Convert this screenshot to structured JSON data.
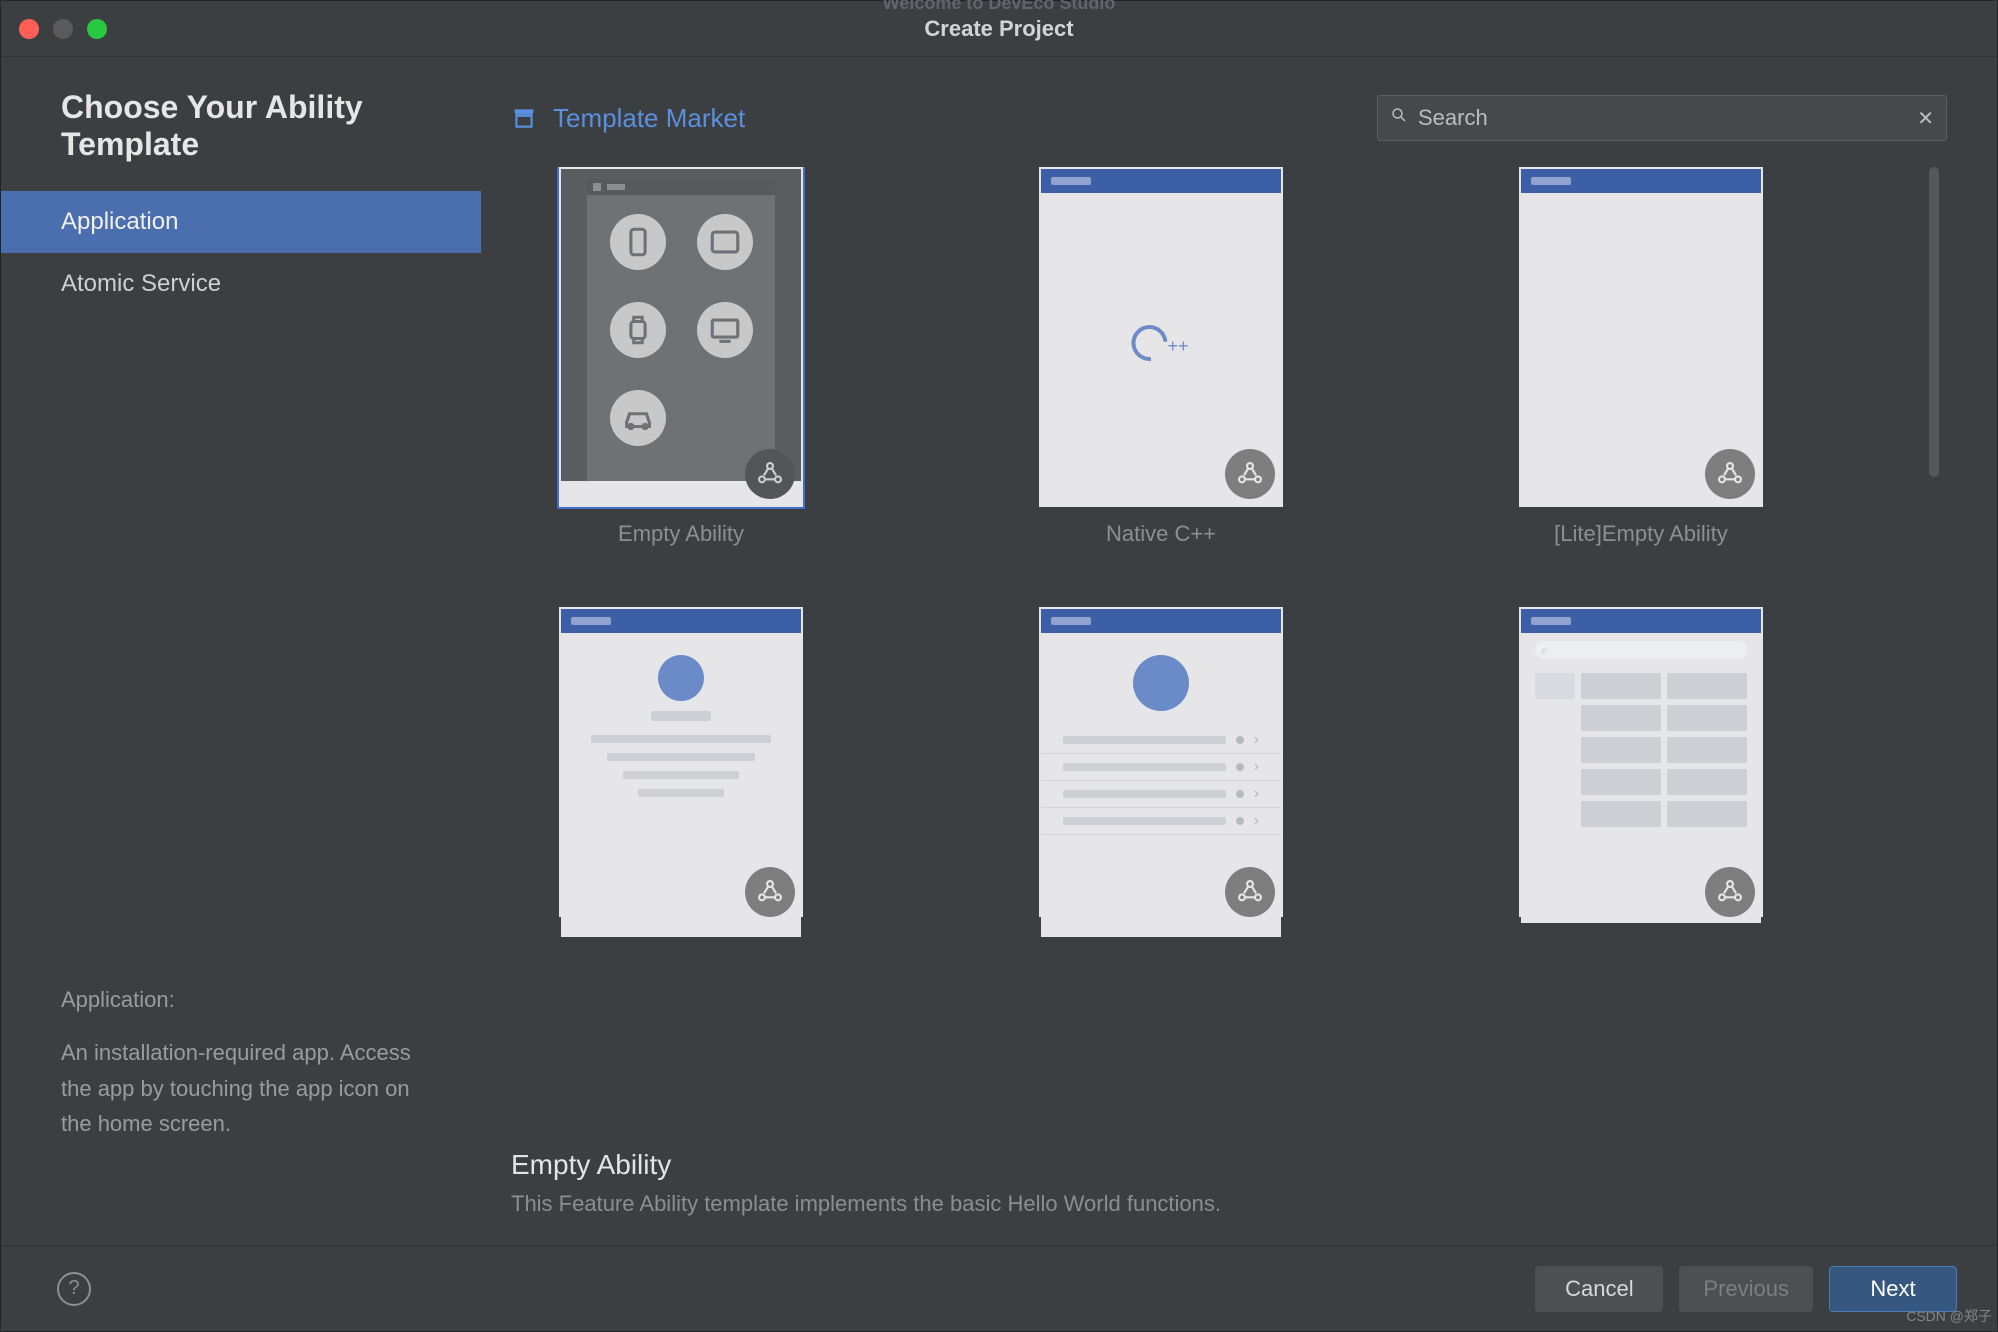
{
  "window": {
    "bg_title": "Welcome to DevEco Studio",
    "title": "Create Project"
  },
  "sidebar": {
    "heading": "Choose Your Ability Template",
    "tabs": [
      {
        "label": "Application",
        "active": true
      },
      {
        "label": "Atomic Service",
        "active": false
      }
    ],
    "desc_label": "Application:",
    "desc_body": "An installation-required app. Access the app by touching the app icon on the home screen."
  },
  "main": {
    "market_label": "Template Market",
    "search_placeholder": "Search",
    "templates": [
      {
        "label": "Empty Ability",
        "kind": "empty",
        "selected": true
      },
      {
        "label": "Native C++",
        "kind": "cpp",
        "selected": false
      },
      {
        "label": "[Lite]Empty Ability",
        "kind": "lite",
        "selected": false
      },
      {
        "label": "",
        "kind": "list",
        "selected": false
      },
      {
        "label": "",
        "kind": "list2",
        "selected": false
      },
      {
        "label": "",
        "kind": "gridcat",
        "selected": false
      }
    ],
    "selected_title": "Empty Ability",
    "selected_desc": "This Feature Ability template implements the basic Hello World functions."
  },
  "footer": {
    "cancel": "Cancel",
    "previous": "Previous",
    "next": "Next"
  },
  "watermark": "CSDN @郑子"
}
